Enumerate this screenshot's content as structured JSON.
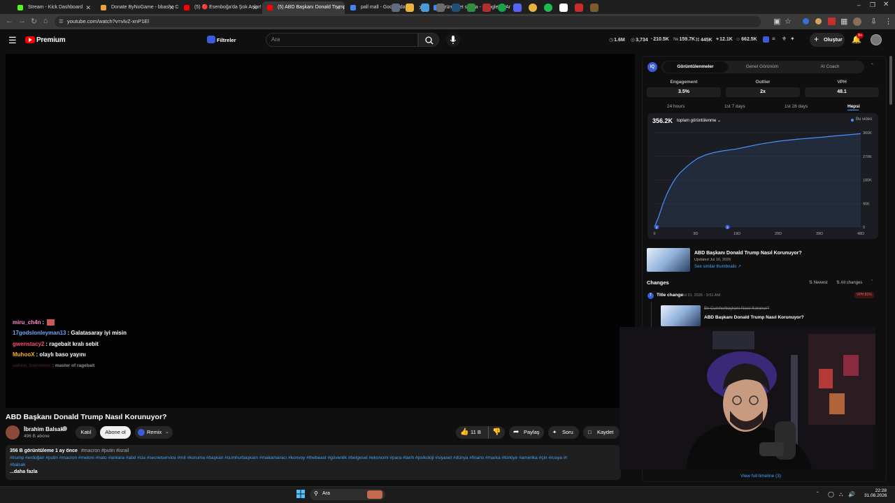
{
  "browser": {
    "tabs": [
      {
        "title": "Stream - Kick Dashboard",
        "color": "#53fc18",
        "active": false
      },
      {
        "title": "Donate ByNoGame - bbasho D",
        "color": "#e8a33d",
        "active": false
      },
      {
        "title": "(5) 🔴 Esenboğa'da Şok Anlar! Pu",
        "color": "#ff0000",
        "active": false
      },
      {
        "title": "(5) ABD Başkanı Donald Trump",
        "color": "#ff0000",
        "active": true
      },
      {
        "title": "pall mall - Google'da Ara",
        "color": "#4285f4",
        "active": false
      },
      {
        "title": "zümerret sigara - Google'da Ar",
        "color": "#4285f4",
        "active": false
      }
    ],
    "new_tab": "+",
    "url": "youtube.com/watch?v=vlvZ-xnP1El"
  },
  "yt": {
    "brand": "Premium",
    "filters_label": "Filtreler",
    "search_placeholder": "Ara",
    "stats": [
      "1.6M",
      "3,734",
      "210.5K",
      "159.7K",
      "445K",
      "12.1K",
      "662.5K"
    ],
    "create_label": "Oluştur",
    "notif_count": "9+"
  },
  "chat": [
    {
      "user": "miru_ch4n",
      "msg": ":",
      "color": "#ff8cc6"
    },
    {
      "user": "17godslonleyman13",
      "msg": ": Galatasaray iyi misin",
      "color": "#6ea8ff"
    },
    {
      "user": "gwenstacy2",
      "msg": ": ragebait kralı sebit",
      "color": "#ff4f6e"
    },
    {
      "user": "MuhooX",
      "msg": ": olaylı baso yayını",
      "color": "#ffb020"
    },
    {
      "user": "sallam_bammmer",
      "msg": ": master of ragebait",
      "color": "#7a2a2a"
    }
  ],
  "video": {
    "title": "ABD Başkanı Donald Trump Nasıl Korunuyor?",
    "channel": "İbrahim Balsak",
    "subs": "496 B abone",
    "join": "Katıl",
    "subscribe": "Abone ol",
    "remix": "Remix",
    "likes": "11 B",
    "share": "Paylaş",
    "ask": "Soru",
    "save": "Kaydet",
    "views_date": "356 B görüntüleme  1 ay önce",
    "top_tags": "#macron #putin #israil",
    "hashtags": "#trump #erdoğan #putin #macron #meloni #nato #ankara #abd #cia #secretservice #mit #koruma #başkan #cumhurbaşkanı #makamaracı #konvoy #thebeast #güvenlik #belgesel #ekonomi #para #tarih #psikoloji #siyaset #dünya #finans #marka #türkiye #amerika #çin #rusya #r",
    "hashtags2": "#balsak",
    "more": "...daha fazla"
  },
  "panel": {
    "tabs": [
      "Görüntülenmeler",
      "Genel Görünüm",
      "AI Coach"
    ],
    "metrics": [
      {
        "label": "Engagement",
        "value": "3.5%"
      },
      {
        "label": "Outlier",
        "value": "2x"
      },
      {
        "label": "VPH",
        "value": "48.1"
      }
    ],
    "ranges": [
      "24 hours",
      "1st 7 days",
      "1st 28 days",
      "Hepsi"
    ],
    "total": "356.2K",
    "total_label": "toplam görüntülenme",
    "legend": "Bu video",
    "video_title": "ABD Başkanı Donald Trump Nasıl Korunuyor?",
    "updated": "Updated Jul 16, 2026",
    "similar": "See similar thumbnails ↗",
    "changes_label": "Changes",
    "newest": "Newest",
    "all_changes": "All changes",
    "change_type": "Title change",
    "change_date": "Jul 31, 2026 · 9:51 AM",
    "vph": "VPH 81%",
    "old_title": "Bir Cumhurbaşkanı Nasıl Korunur?",
    "new_title": "ABD Başkanı Donald Trump Nasıl Korunuyor?",
    "full_timeline": "View full timeline (3)"
  },
  "taskbar": {
    "search": "Ara",
    "time": "22:28",
    "date": "31.08.2026"
  },
  "chart_data": {
    "type": "area",
    "xlabel": "",
    "ylabel": "",
    "x_ticks": [
      "0",
      "9D",
      "19D",
      "29D",
      "39D",
      "48D"
    ],
    "y_ticks": [
      "360K",
      "270K",
      "180K",
      "90K",
      "0"
    ],
    "ylim": [
      0,
      360000
    ],
    "xlim": [
      0,
      48
    ],
    "series": [
      {
        "name": "Bu video",
        "x": [
          0,
          1,
          2,
          3,
          4,
          5,
          6,
          8,
          10,
          12,
          14,
          16,
          19,
          22,
          25,
          29,
          33,
          36,
          39,
          42,
          45,
          48
        ],
        "y": [
          0,
          40000,
          90000,
          130000,
          162000,
          188000,
          208000,
          238000,
          262000,
          276000,
          285000,
          291000,
          298000,
          308000,
          318000,
          328000,
          335000,
          339000,
          343000,
          348000,
          352000,
          356200
        ]
      }
    ],
    "markers": [
      {
        "x": 0.5,
        "label": "2"
      },
      {
        "x": 17,
        "label": "2"
      }
    ],
    "color": "#4a90ff",
    "grid": true
  }
}
